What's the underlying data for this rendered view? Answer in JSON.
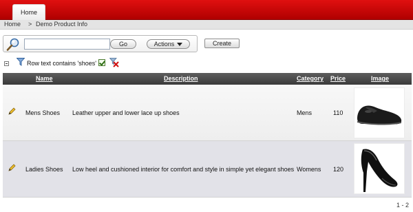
{
  "nav": {
    "home_tab": "Home"
  },
  "breadcrumb": {
    "home": "Home",
    "separator": ">",
    "current": "Demo Product Info"
  },
  "search": {
    "placeholder": "",
    "value": "",
    "go_label": "Go",
    "actions_label": "Actions"
  },
  "toolbar": {
    "create_label": "Create"
  },
  "filter": {
    "text": "Row text contains 'shoes'"
  },
  "table": {
    "columns": [
      "Name",
      "Description",
      "Category",
      "Price",
      "Image"
    ],
    "rows": [
      {
        "name": "Mens Shoes",
        "description": "Leather upper and lower lace up shoes",
        "category": "Mens",
        "price": "110",
        "image": "mens-shoe"
      },
      {
        "name": "Ladies Shoes",
        "description": "Low heel and cushioned interior for comfort and style in simple yet elegant shoes",
        "category": "Womens",
        "price": "120",
        "image": "ladies-shoe"
      }
    ]
  },
  "pagination": {
    "range": "1 - 2"
  },
  "colors": {
    "header_red": "#c40000",
    "table_header": "#4a4a4a",
    "row_alt": "#e2e2e8"
  }
}
